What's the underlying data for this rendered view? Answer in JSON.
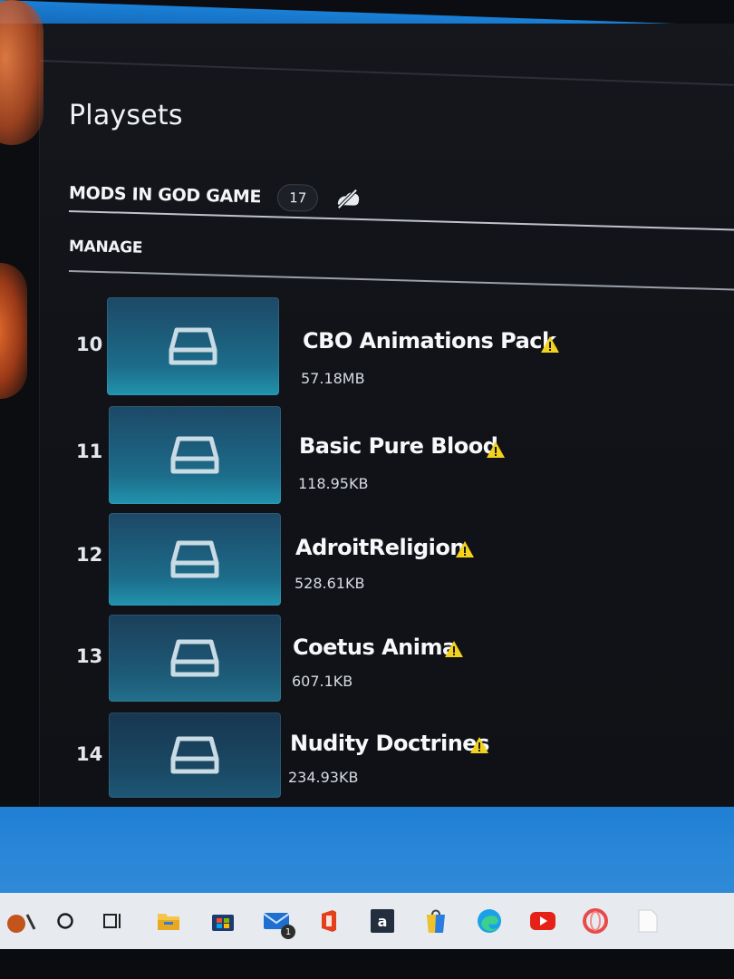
{
  "section_title": "Playsets",
  "playset": {
    "label": "MODS IN GOD GAME",
    "count": "17"
  },
  "manage_label": "MANAGE",
  "mods": [
    {
      "index": "10",
      "name": "CBO Animations Pack",
      "size": "57.18MB",
      "warning": true
    },
    {
      "index": "11",
      "name": "Basic Pure Blood",
      "size": "118.95KB",
      "warning": true
    },
    {
      "index": "12",
      "name": "AdroitReligion",
      "size": "528.61KB",
      "warning": true
    },
    {
      "index": "13",
      "name": "Coetus Anima",
      "size": "607.1KB",
      "warning": true
    },
    {
      "index": "14",
      "name": "Nudity Doctrines",
      "size": "234.93KB",
      "warning": true
    }
  ],
  "taskbar": {
    "items": [
      "search-icon",
      "task-view-icon",
      "file-explorer-icon",
      "store-icon",
      "mail-icon",
      "office-icon",
      "amazon-icon",
      "bag-icon",
      "edge-icon",
      "youtube-icon",
      "opera-icon",
      "notes-icon"
    ],
    "mail_badge": "1"
  },
  "colors": {
    "accent_thumb": "#1c6c8a",
    "warning": "#f2d21c",
    "panel_bg": "#111318"
  }
}
